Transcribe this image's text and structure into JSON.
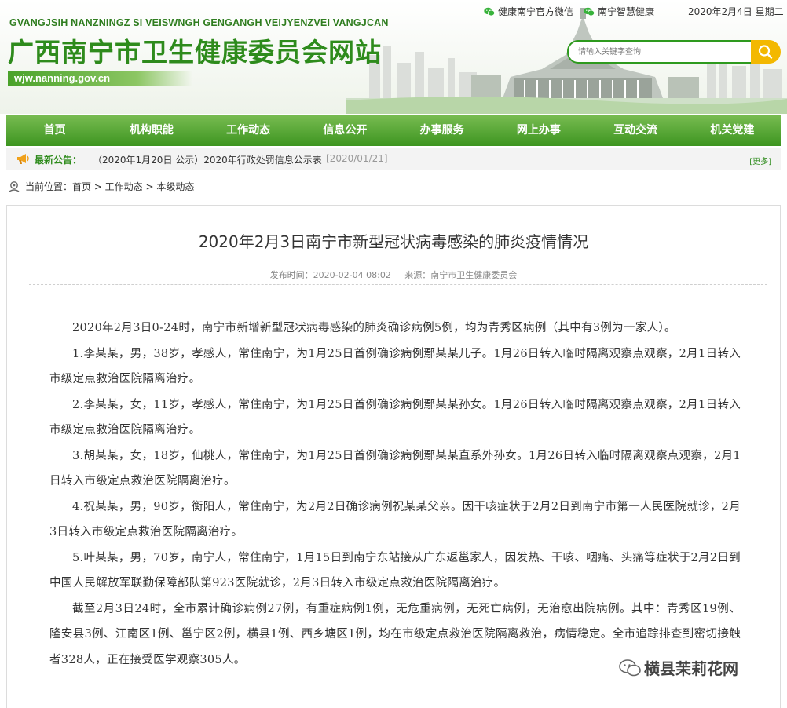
{
  "header": {
    "pinyin": "GVANGJSIH NANZNINGZ SI VEISWNGH GENGANGH VEIJYENZVEI VANGJCAN",
    "title": "广西南宁市卫生健康委员会网站",
    "domain": "wjw.nanning.gov.cn",
    "links": [
      "健康南宁官方微信",
      "南宁智慧健康"
    ],
    "date": "2020年2月4日 星期二",
    "search_placeholder": "请输入关键字查询"
  },
  "nav": {
    "items": [
      "首页",
      "机构职能",
      "工作动态",
      "信息公开",
      "办事服务",
      "网上办事",
      "互动交流",
      "机关党建"
    ]
  },
  "notice": {
    "label": "最新公告：",
    "text": "（2020年1月20日 公示）2020年行政处罚信息公示表",
    "date": "[2020/01/21]",
    "more": "[更多]"
  },
  "breadcrumb": {
    "text": "当前位置：首页 > 工作动态 > 本级动态"
  },
  "article": {
    "title": "2020年2月3日南宁市新型冠状病毒感染的肺炎疫情情况",
    "meta": "发布时间：2020-02-04 08:02     来源：南宁市卫生健康委员会",
    "paragraphs": [
      "2020年2月3日0-24时，南宁市新增新型冠状病毒感染的肺炎确诊病例5例，均为青秀区病例（其中有3例为一家人）。",
      "1.李某某，男，38岁，孝感人，常住南宁，为1月25日首例确诊病例鄢某某儿子。1月26日转入临时隔离观察点观察，2月1日转入市级定点救治医院隔离治疗。",
      "2.李某某，女，11岁，孝感人，常住南宁，为1月25日首例确诊病例鄢某某孙女。1月26日转入临时隔离观察点观察，2月1日转入市级定点救治医院隔离治疗。",
      "3.胡某某，女，18岁，仙桃人，常住南宁，为1月25日首例确诊病例鄢某某直系外孙女。1月26日转入临时隔离观察点观察，2月1日转入市级定点救治医院隔离治疗。",
      "4.祝某某，男，90岁，衡阳人，常住南宁，为2月2日确诊病例祝某某父亲。因干咳症状于2月2日到南宁市第一人民医院就诊，2月3日转入市级定点救治医院隔离治疗。",
      "5.叶某某，男，70岁，南宁人，常住南宁，1月15日到南宁东站接从广东返邕家人，因发热、干咳、咽痛、头痛等症状于2月2日到中国人民解放军联勤保障部队第923医院就诊，2月3日转入市级定点救治医院隔离治疗。",
      "截至2月3日24时，全市累计确诊病例27例，有重症病例1例，无危重病例，无死亡病例，无治愈出院病例。其中：青秀区19例、隆安县3例、江南区1例、邕宁区2例，横县1例、西乡塘区1例，均在市级定点救治医院隔离救治，病情稳定。全市追踪排查到密切接触者328人，正在接受医学观察305人。"
    ]
  },
  "watermark": "横县茉莉花网"
}
